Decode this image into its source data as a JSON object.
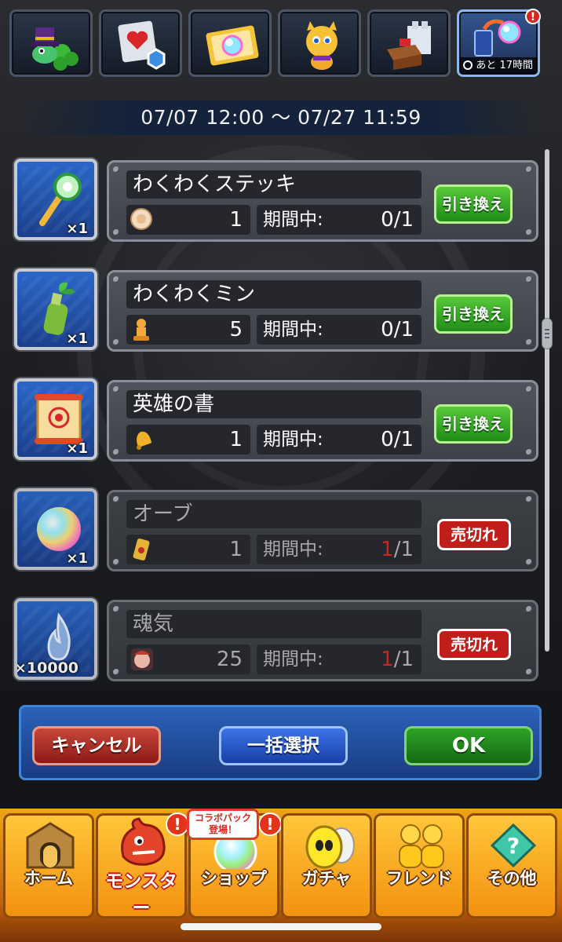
{
  "colors": {
    "accent_blue": "#2b62b8",
    "exchange_green": "#2f9f22",
    "soldout_red": "#bf1e1a",
    "nav_orange": "#f39111"
  },
  "top_tabs": [
    {
      "icon": "clover-hat-icon"
    },
    {
      "icon": "heart-card-icon"
    },
    {
      "icon": "rainbow-ticket-icon"
    },
    {
      "icon": "dragon-character-icon"
    },
    {
      "icon": "castle-chest-icon"
    },
    {
      "icon": "orb-exchange-icon",
      "timer": "あと 17時間",
      "badge": "!"
    }
  ],
  "period": "07/07 12:00 ～ 07/27 11:59",
  "items": [
    {
      "name": "わくわくステッキ",
      "item_icon": "magic-wand-icon",
      "quantity": "×1",
      "cost_icon": "medal-token-icon",
      "cost": "1",
      "limit_label": "期間中:",
      "limit_used": "0",
      "limit_total": "/1",
      "status": "exchange",
      "button_label": "引き換え"
    },
    {
      "name": "わくわくミン",
      "item_icon": "sprout-bottle-icon",
      "quantity": "×1",
      "cost_icon": "pawn-token-icon",
      "cost": "5",
      "limit_label": "期間中:",
      "limit_used": "0",
      "limit_total": "/1",
      "status": "exchange",
      "button_label": "引き換え"
    },
    {
      "name": "英雄の書",
      "item_icon": "hero-scroll-icon",
      "quantity": "×1",
      "cost_icon": "bell-token-icon",
      "cost": "1",
      "limit_label": "期間中:",
      "limit_used": "0",
      "limit_total": "/1",
      "status": "exchange",
      "button_label": "引き換え"
    },
    {
      "name": "オーブ",
      "item_icon": "rainbow-orb-icon",
      "quantity": "×1",
      "cost_icon": "can-token-icon",
      "cost": "1",
      "limit_label": "期間中:",
      "limit_used": "1",
      "limit_total": "/1",
      "status": "soldout",
      "button_label": "売切れ"
    },
    {
      "name": "魂気",
      "item_icon": "soul-flame-icon",
      "quantity": "×10000",
      "cost_icon": "monster-face-token-icon",
      "cost": "25",
      "limit_label": "期間中:",
      "limit_used": "1",
      "limit_total": "/1",
      "status": "soldout",
      "button_label": "売切れ"
    }
  ],
  "actions": {
    "cancel": "キャンセル",
    "bulk_select": "一括選択",
    "ok": "OK"
  },
  "collab_banner": {
    "line1": "コラボパック",
    "line2": "登場！"
  },
  "nav": [
    {
      "label": "ホーム",
      "icon": "home-door-icon"
    },
    {
      "label": "モンスター",
      "icon": "monster-icon",
      "badge": "!"
    },
    {
      "label": "ショップ",
      "icon": "shop-orb-icon",
      "badge": "!"
    },
    {
      "label": "ガチャ",
      "icon": "gacha-egg-icon"
    },
    {
      "label": "フレンド",
      "icon": "friends-icon"
    },
    {
      "label": "その他",
      "icon": "other-menu-icon"
    }
  ]
}
